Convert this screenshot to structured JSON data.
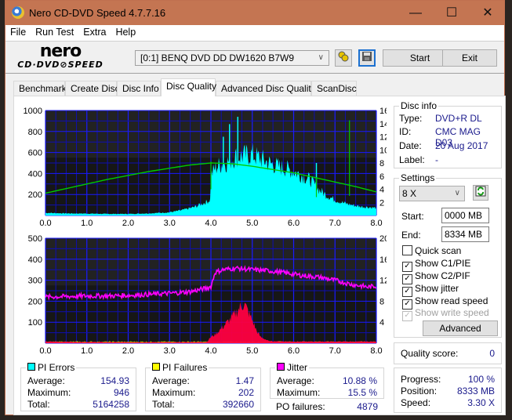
{
  "window": {
    "title": "Nero CD-DVD Speed 4.7.7.16",
    "controls": {
      "minimize": "—",
      "maximize": "☐",
      "close": "✕"
    }
  },
  "menu": [
    "File",
    "Run Test",
    "Extra",
    "Help"
  ],
  "toolbar": {
    "logo_top": "nero",
    "logo_bottom": "CD·DVD⊘SPEED",
    "drive_selected": "[0:1]  BENQ DVD DD DW1620 B7W9",
    "start_label": "Start",
    "exit_label": "Exit"
  },
  "tabs": [
    {
      "label": "Benchmark",
      "active": false
    },
    {
      "label": "Create Disc",
      "active": false
    },
    {
      "label": "Disc Info",
      "active": false
    },
    {
      "label": "Disc Quality",
      "active": true
    },
    {
      "label": "Advanced Disc Quality",
      "active": false
    },
    {
      "label": "ScanDisc",
      "active": false
    }
  ],
  "disc_info": {
    "title": "Disc info",
    "type_label": "Type:",
    "type": "DVD+R DL",
    "id_label": "ID:",
    "id": "CMC MAG D03",
    "date_label": "Date:",
    "date": "20 Aug 2017",
    "label_label": "Label:",
    "label": "-"
  },
  "settings": {
    "title": "Settings",
    "speed": "8 X",
    "start_label": "Start:",
    "start": "0000 MB",
    "end_label": "End:",
    "end": "8334 MB",
    "checkboxes": [
      {
        "label": "Quick scan",
        "checked": false,
        "enabled": true
      },
      {
        "label": "Show C1/PIE",
        "checked": true,
        "enabled": true
      },
      {
        "label": "Show C2/PIF",
        "checked": true,
        "enabled": true
      },
      {
        "label": "Show jitter",
        "checked": true,
        "enabled": true
      },
      {
        "label": "Show read speed",
        "checked": true,
        "enabled": true
      },
      {
        "label": "Show write speed",
        "checked": true,
        "enabled": false
      }
    ],
    "advanced_label": "Advanced"
  },
  "quality": {
    "label": "Quality score:",
    "value": "0"
  },
  "progress": {
    "progress_label": "Progress:",
    "progress": "100 %",
    "position_label": "Position:",
    "position": "8333 MB",
    "speed_label": "Speed:",
    "speed": "3.30 X"
  },
  "stats": {
    "pi_errors": {
      "title": "PI Errors",
      "color": "#00ffff",
      "average_label": "Average:",
      "average": "154.93",
      "maximum_label": "Maximum:",
      "maximum": "946",
      "total_label": "Total:",
      "total": "5164258"
    },
    "pi_failures": {
      "title": "PI Failures",
      "color": "#ffff00",
      "average_label": "Average:",
      "average": "1.47",
      "maximum_label": "Maximum:",
      "maximum": "202",
      "total_label": "Total:",
      "total": "392660"
    },
    "jitter": {
      "title": "Jitter",
      "color": "#ff00ff",
      "average_label": "Average:",
      "average": "10.88 %",
      "maximum_label": "Maximum:",
      "maximum": "15.5 %"
    },
    "po_failures_label": "PO failures:",
    "po_failures": "4879"
  },
  "chart_data": [
    {
      "type": "area",
      "title": "PI Errors / Read Speed",
      "x_ticks": [
        "0.0",
        "1.0",
        "2.0",
        "3.0",
        "4.0",
        "5.0",
        "6.0",
        "7.0",
        "8.0"
      ],
      "xlim": [
        0,
        8
      ],
      "y_left_ticks": [
        "1000",
        "800",
        "600",
        "400",
        "200"
      ],
      "ylim_left": [
        0,
        1000
      ],
      "y_right_ticks": [
        "16",
        "14",
        "12",
        "10",
        "8",
        "6",
        "4",
        "2"
      ],
      "ylim_right": [
        0,
        16
      ],
      "grid": true,
      "series": [
        {
          "name": "PI Errors",
          "color": "#00ffff",
          "axis": "left",
          "x": [
            0,
            0.5,
            1,
            1.5,
            2,
            2.5,
            3,
            3.3,
            3.6,
            3.9,
            3.99,
            4.0,
            4.1,
            4.2,
            4.4,
            4.6,
            4.8,
            5.0,
            5.2,
            5.4,
            5.6,
            5.8,
            6.0,
            6.2,
            6.4,
            6.6,
            6.8,
            7.0,
            7.2,
            7.4,
            7.6,
            7.8,
            8.0
          ],
          "values": [
            25,
            20,
            18,
            15,
            15,
            20,
            30,
            50,
            80,
            130,
            150,
            380,
            450,
            480,
            510,
            560,
            570,
            580,
            540,
            500,
            470,
            450,
            420,
            380,
            340,
            250,
            190,
            150,
            120,
            100,
            85,
            80,
            70
          ]
        },
        {
          "name": "PI Errors spikes",
          "color": "#00ffff",
          "axis": "left",
          "x": [
            4.3,
            4.45,
            4.65,
            6.55
          ],
          "values": [
            750,
            870,
            940,
            500
          ]
        },
        {
          "name": "Read Speed",
          "color": "#00cc00",
          "axis": "right",
          "x": [
            0,
            0.5,
            1,
            1.5,
            2,
            2.5,
            3,
            3.5,
            4,
            4.5,
            5,
            5.5,
            6,
            6.5,
            7,
            7.5,
            8
          ],
          "values": [
            3.4,
            4.1,
            4.8,
            5.5,
            6.1,
            6.7,
            7.2,
            7.7,
            8.0,
            7.9,
            7.5,
            7.0,
            6.5,
            5.8,
            5.1,
            4.4,
            3.6
          ]
        }
      ]
    },
    {
      "type": "area",
      "title": "PI Failures / Jitter",
      "x_ticks": [
        "0.0",
        "1.0",
        "2.0",
        "3.0",
        "4.0",
        "5.0",
        "6.0",
        "7.0",
        "8.0"
      ],
      "xlim": [
        0,
        8
      ],
      "y_left_ticks": [
        "500",
        "400",
        "300",
        "200",
        "100"
      ],
      "ylim_left": [
        0,
        500
      ],
      "y_right_ticks": [
        "20",
        "16",
        "12",
        "8",
        "4"
      ],
      "ylim_right": [
        0,
        20
      ],
      "grid": true,
      "series": [
        {
          "name": "PI Failures",
          "color": "#ff0040",
          "axis": "left",
          "x": [
            0,
            1,
            2,
            3,
            3.9,
            4.0,
            4.1,
            4.3,
            4.5,
            4.7,
            4.8,
            4.9,
            5.0,
            5.1,
            5.2,
            5.4,
            6,
            7,
            8
          ],
          "values": [
            8,
            6,
            5,
            5,
            6,
            30,
            40,
            80,
            120,
            170,
            190,
            150,
            110,
            60,
            30,
            10,
            8,
            8,
            8
          ]
        },
        {
          "name": "Jitter",
          "color": "#ff00ff",
          "axis": "right",
          "x": [
            0,
            0.5,
            1,
            1.5,
            2,
            2.5,
            3,
            3.5,
            3.9,
            4.0,
            4.1,
            4.3,
            4.6,
            5.0,
            5.4,
            5.8,
            6.2,
            6.6,
            7.0,
            7.4,
            7.8,
            8.0
          ],
          "values": [
            8.8,
            8.9,
            9.0,
            9.0,
            9.1,
            9.3,
            9.5,
            9.8,
            10.5,
            10.8,
            13.5,
            14.0,
            14.3,
            14.0,
            13.8,
            13.4,
            12.9,
            12.6,
            12.0,
            11.2,
            10.7,
            10.9
          ]
        }
      ]
    }
  ]
}
